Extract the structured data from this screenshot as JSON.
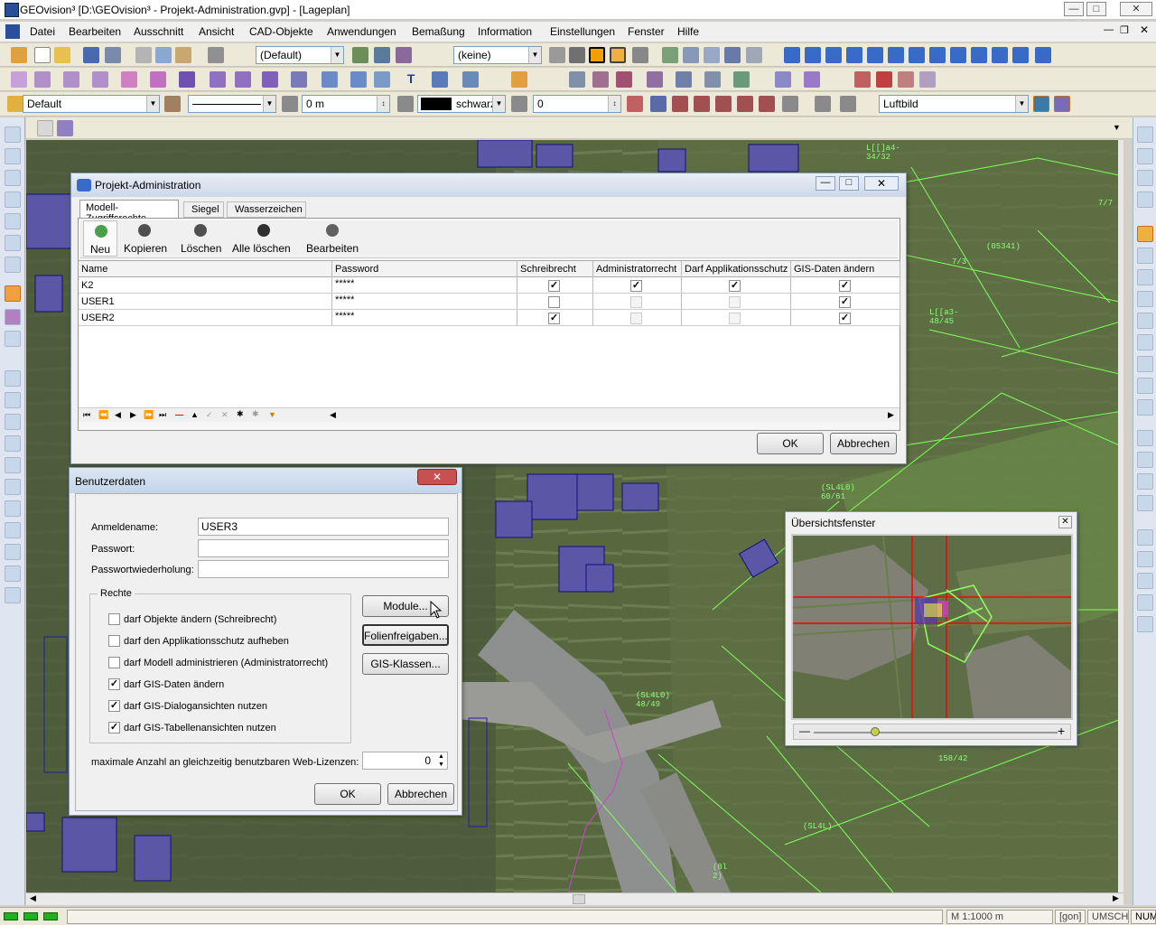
{
  "window": {
    "title": "GEOvision³  [D:\\GEOvision³ - Projekt-Administration.gvp] - [Lageplan]"
  },
  "menu": [
    "Datei",
    "Bearbeiten",
    "Ausschnitt",
    "Ansicht",
    "CAD-Objekte",
    "Anwendungen",
    "Bemaßung",
    "Information",
    "Einstellungen",
    "Fenster",
    "Hilfe"
  ],
  "toolbar1": {
    "style_combo": "(Default)",
    "filter_combo": "(keine)"
  },
  "toolbar3": {
    "layer_combo": "Default",
    "offset": "0 m",
    "color_label": "schwarz",
    "angle": "0",
    "background_combo": "Luftbild"
  },
  "colors": {
    "map_base": "#5b6b49",
    "cadastre_line": "#7fff5a",
    "building_fill": "#5a57a6",
    "accent_red": "#ff0000"
  },
  "map_labels": [
    "L[[]a4-\n34/32",
    "(05341)",
    "7/3",
    "7/7",
    "L[[a3-\n48/45",
    "(SL4L0)\n60/61",
    "(SL4L0)\n48/49",
    "158/42",
    "(8l\n2)",
    "(SL4L)"
  ],
  "proj_admin": {
    "title": "Projekt-Administration",
    "tabs": [
      "Modell-Zugriffsrechte",
      "Siegel",
      "Wasserzeichen"
    ],
    "actions": [
      "Neu",
      "Kopieren",
      "Löschen",
      "Alle löschen",
      "Bearbeiten"
    ],
    "columns": [
      "Name",
      "Password",
      "Schreibrecht",
      "Administratorrecht",
      "Darf Applikationsschutz",
      "GIS-Daten ändern"
    ],
    "rows": [
      {
        "name": "K2",
        "password": "*****",
        "write": true,
        "admin": true,
        "appschutz": true,
        "gis": true
      },
      {
        "name": "USER1",
        "password": "*****",
        "write": false,
        "admin": false,
        "appschutz": false,
        "gis": true
      },
      {
        "name": "USER2",
        "password": "*****",
        "write": true,
        "admin": false,
        "appschutz": false,
        "gis": true
      }
    ],
    "ok": "OK",
    "cancel": "Abbrechen"
  },
  "benutzer": {
    "title": "Benutzerdaten",
    "login_label": "Anmeldename:",
    "login_value": "USER3",
    "pw_label": "Passwort:",
    "pw2_label": "Passwortwiederholung:",
    "rights_title": "Rechte",
    "rights": [
      {
        "label": "darf Objekte ändern (Schreibrecht)",
        "checked": false
      },
      {
        "label": "darf den Applikationsschutz aufheben",
        "checked": false
      },
      {
        "label": "darf Modell administrieren (Administratorrecht)",
        "checked": false
      },
      {
        "label": "darf GIS-Daten ändern",
        "checked": true
      },
      {
        "label": "darf GIS-Dialogansichten nutzen",
        "checked": true
      },
      {
        "label": "darf GIS-Tabellenansichten nutzen",
        "checked": true
      }
    ],
    "module_btn": "Module...",
    "folien_btn": "Folienfreigaben...",
    "gis_btn": "GIS-Klassen...",
    "license_label": "maximale Anzahl an gleichzeitig benutzbaren Web-Lizenzen:",
    "license_value": "0",
    "ok": "OK",
    "cancel": "Abbrechen"
  },
  "overview": {
    "title": "Übersichtsfenster",
    "zoom_position": 0.25
  },
  "status": {
    "scale": "M 1:1000  m",
    "unit": "[gon]",
    "caps": "UMSCH",
    "num": "NUM"
  }
}
